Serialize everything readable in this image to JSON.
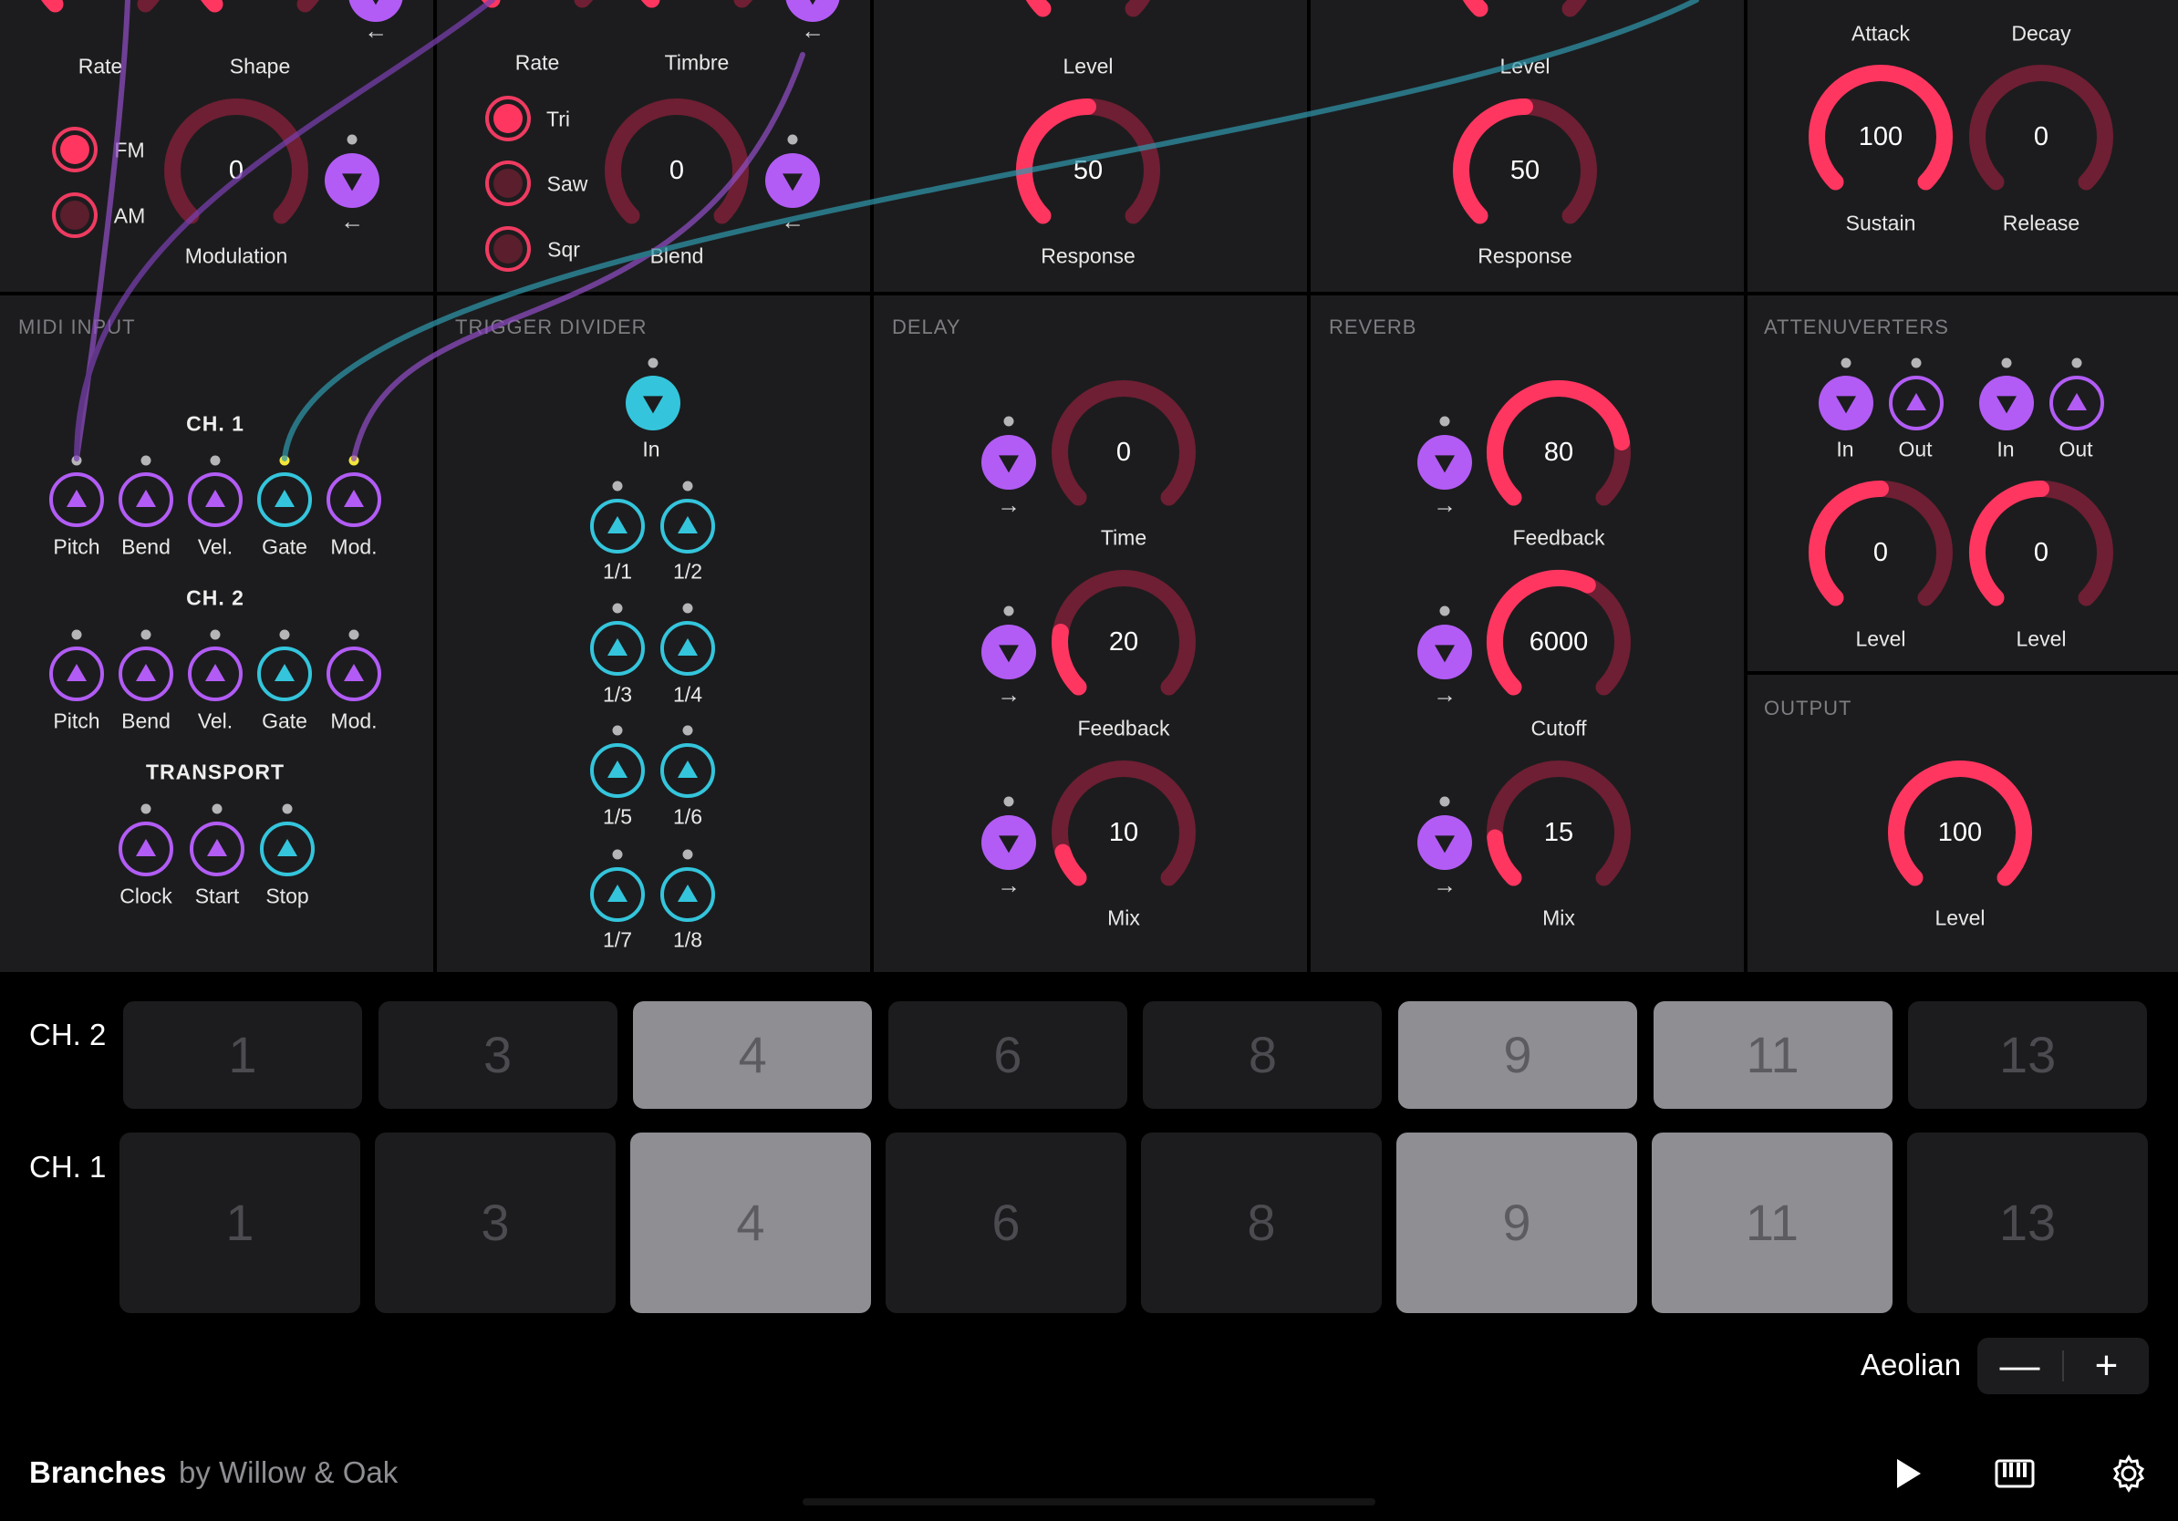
{
  "app": {
    "name": "Branches",
    "byline": "by Willow & Oak"
  },
  "colors": {
    "module_bg": "#1c1c1e",
    "accent_red": "#ff3660",
    "track_red": "#6e1f33",
    "port_purple": "#b25cf5",
    "port_cyan": "#34c5dc",
    "pad_on": "#8e8e93",
    "pad_off": "#1c1c1e"
  },
  "top_modules": {
    "lfo": {
      "knob_rate": "Rate",
      "knob_shape": "Shape",
      "radio_fm": "FM",
      "radio_am": "AM",
      "modulation": {
        "label": "Modulation",
        "value": "0",
        "level": 0
      },
      "arrow": "←"
    },
    "oscillator": {
      "knob_rate": "Rate",
      "knob_timbre": "Timbre",
      "radio_tri": "Tri",
      "radio_saw": "Saw",
      "radio_sqr": "Sqr",
      "blend": {
        "label": "Blend",
        "value": "0",
        "level": 0
      },
      "arrow": "←"
    },
    "vca1": {
      "level_label": "Level",
      "response": {
        "label": "Response",
        "value": "50",
        "level": 0.5
      }
    },
    "vca2": {
      "level_label": "Level",
      "response": {
        "label": "Response",
        "value": "50",
        "level": 0.5
      }
    },
    "envelope": {
      "attack_label": "Attack",
      "decay_label": "Decay",
      "sustain": {
        "label": "Sustain",
        "value": "100",
        "level": 1.0
      },
      "release": {
        "label": "Release",
        "value": "0",
        "level": 0
      }
    }
  },
  "midi_input": {
    "title": "MIDI INPUT",
    "ch1": {
      "title": "CH. 1",
      "ports": [
        "Pitch",
        "Bend",
        "Vel.",
        "Gate",
        "Mod."
      ]
    },
    "ch2": {
      "title": "CH. 2",
      "ports": [
        "Pitch",
        "Bend",
        "Vel.",
        "Gate",
        "Mod."
      ]
    },
    "transport": {
      "title": "TRANSPORT",
      "ports": [
        "Clock",
        "Start",
        "Stop"
      ]
    }
  },
  "trigger_divider": {
    "title": "TRIGGER DIVIDER",
    "input_label": "In",
    "outputs": [
      "1/1",
      "1/2",
      "1/3",
      "1/4",
      "1/5",
      "1/6",
      "1/7",
      "1/8"
    ]
  },
  "delay": {
    "title": "DELAY",
    "arrow": "→",
    "time": {
      "label": "Time",
      "value": "0",
      "level": 0
    },
    "feedback": {
      "label": "Feedback",
      "value": "20",
      "level": 0.2
    },
    "mix": {
      "label": "Mix",
      "value": "10",
      "level": 0.1
    }
  },
  "reverb": {
    "title": "REVERB",
    "arrow": "→",
    "feedback": {
      "label": "Feedback",
      "value": "80",
      "level": 0.8
    },
    "cutoff": {
      "label": "Cutoff",
      "value": "6000",
      "level": 0.6
    },
    "mix": {
      "label": "Mix",
      "value": "15",
      "level": 0.15
    }
  },
  "attenuverters": {
    "title": "ATTENUVERTERS",
    "ports": [
      "In",
      "Out",
      "In",
      "Out"
    ],
    "level1": {
      "label": "Level",
      "value": "0"
    },
    "level2": {
      "label": "Level",
      "value": "0"
    }
  },
  "output": {
    "title": "OUTPUT",
    "level": {
      "label": "Level",
      "value": "100",
      "level": 1.0
    }
  },
  "pads": {
    "ch2": {
      "label": "CH. 2",
      "numbers": [
        "1",
        "3",
        "4",
        "6",
        "8",
        "9",
        "11",
        "13"
      ],
      "active": [
        false,
        false,
        true,
        false,
        false,
        true,
        true,
        false
      ]
    },
    "ch1": {
      "label": "CH. 1",
      "numbers": [
        "1",
        "3",
        "4",
        "6",
        "8",
        "9",
        "11",
        "13"
      ],
      "active": [
        false,
        false,
        true,
        false,
        false,
        true,
        true,
        false
      ]
    }
  },
  "scale": {
    "name": "Aeolian",
    "minus": "—",
    "plus": "+"
  },
  "toolbar": {
    "icons": [
      "play-icon",
      "keyboard-icon",
      "gear-icon"
    ]
  }
}
